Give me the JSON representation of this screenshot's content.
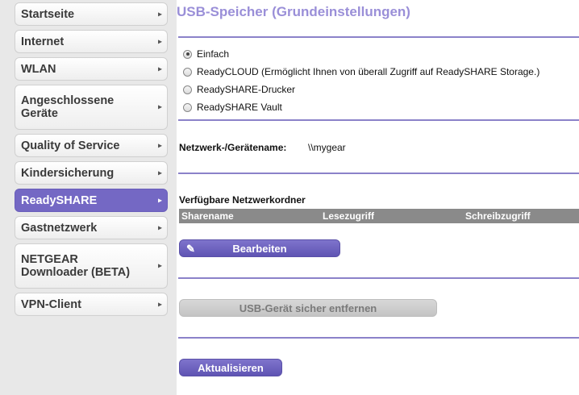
{
  "sidebar": {
    "items": [
      {
        "label": "Startseite",
        "arrow": "▸"
      },
      {
        "label": "Internet",
        "arrow": "▸"
      },
      {
        "label": "WLAN",
        "arrow": "▸"
      },
      {
        "label": "Angeschlossene Geräte",
        "arrow": "▸"
      },
      {
        "label": "Quality of Service",
        "arrow": "▸"
      },
      {
        "label": "Kindersicherung",
        "arrow": "▸"
      },
      {
        "label": "ReadySHARE",
        "arrow": "▸",
        "active": true
      },
      {
        "label": "Gastnetzwerk",
        "arrow": "▸"
      },
      {
        "label": "NETGEAR Downloader (BETA)",
        "arrow": "▸"
      },
      {
        "label": "VPN-Client",
        "arrow": "▸"
      }
    ]
  },
  "main": {
    "title": "USB-Speicher (Grundeinstellungen)",
    "options": [
      {
        "label": "Einfach",
        "checked": true
      },
      {
        "label": "ReadyCLOUD (Ermöglicht Ihnen von überall Zugriff auf ReadySHARE Storage.)",
        "checked": false
      },
      {
        "label": "ReadySHARE-Drucker",
        "checked": false
      },
      {
        "label": "ReadySHARE Vault",
        "checked": false
      }
    ],
    "network_name_label": "Netzwerk-/Gerätename:",
    "network_name_value": "\\\\mygear",
    "folders_title": "Verfügbare Netzwerkordner",
    "table_headers": [
      "Sharename",
      "Lesezugriff",
      "Schreibzugriff"
    ],
    "edit_button": "Bearbeiten",
    "eject_button": "USB-Gerät sicher entfernen",
    "refresh_button": "Aktualisieren"
  },
  "colors": {
    "accent": "#7468c4",
    "title": "#9a8fd8",
    "divider": "#8b82c9",
    "table_header": "#8a8a8a"
  }
}
